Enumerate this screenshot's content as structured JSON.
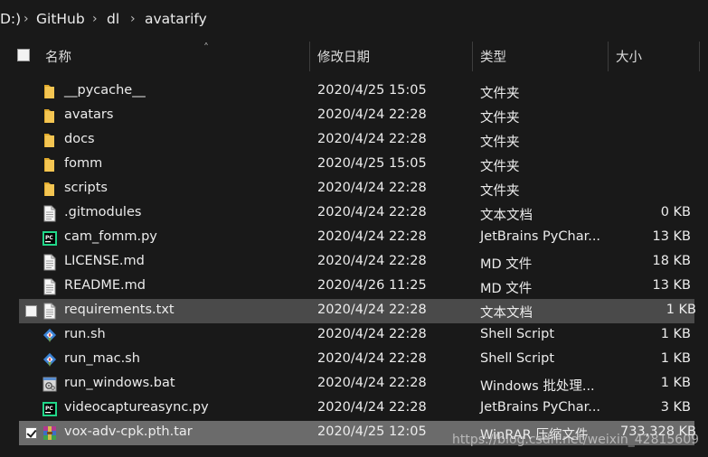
{
  "breadcrumb": {
    "drive": "D:)",
    "items": [
      "GitHub",
      "dl",
      "avatarify"
    ]
  },
  "columns": {
    "name": "名称",
    "date": "修改日期",
    "type": "类型",
    "size": "大小"
  },
  "rows": [
    {
      "name": "__pycache__",
      "date": "2020/4/25 15:05",
      "type": "文件夹",
      "size": "",
      "icon": "folder-icon"
    },
    {
      "name": "avatars",
      "date": "2020/4/24 22:28",
      "type": "文件夹",
      "size": "",
      "icon": "folder-icon"
    },
    {
      "name": "docs",
      "date": "2020/4/24 22:28",
      "type": "文件夹",
      "size": "",
      "icon": "folder-icon"
    },
    {
      "name": "fomm",
      "date": "2020/4/25 15:05",
      "type": "文件夹",
      "size": "",
      "icon": "folder-icon"
    },
    {
      "name": "scripts",
      "date": "2020/4/24 22:28",
      "type": "文件夹",
      "size": "",
      "icon": "folder-icon"
    },
    {
      "name": ".gitmodules",
      "date": "2020/4/24 22:28",
      "type": "文本文档",
      "size": "0 KB",
      "icon": "text-file-icon"
    },
    {
      "name": "cam_fomm.py",
      "date": "2020/4/24 22:28",
      "type": "JetBrains PyChar...",
      "size": "13 KB",
      "icon": "pycharm-file-icon"
    },
    {
      "name": "LICENSE.md",
      "date": "2020/4/24 22:28",
      "type": "MD 文件",
      "size": "18 KB",
      "icon": "text-file-icon"
    },
    {
      "name": "README.md",
      "date": "2020/4/26 11:25",
      "type": "MD 文件",
      "size": "13 KB",
      "icon": "text-file-icon"
    },
    {
      "name": "requirements.txt",
      "date": "2020/4/24 22:28",
      "type": "文本文档",
      "size": "1 KB",
      "icon": "text-file-icon",
      "state": "hover"
    },
    {
      "name": "run.sh",
      "date": "2020/4/24 22:28",
      "type": "Shell Script",
      "size": "1 KB",
      "icon": "shell-script-icon"
    },
    {
      "name": "run_mac.sh",
      "date": "2020/4/24 22:28",
      "type": "Shell Script",
      "size": "1 KB",
      "icon": "shell-script-icon"
    },
    {
      "name": "run_windows.bat",
      "date": "2020/4/24 22:28",
      "type": "Windows 批处理...",
      "size": "1 KB",
      "icon": "batch-file-icon"
    },
    {
      "name": "videocaptureasync.py",
      "date": "2020/4/24 22:28",
      "type": "JetBrains PyChar...",
      "size": "3 KB",
      "icon": "pycharm-file-icon"
    },
    {
      "name": "vox-adv-cpk.pth.tar",
      "date": "2020/4/25 12:05",
      "type": "WinRAR 压缩文件",
      "size": "733,328 KB",
      "icon": "winrar-archive-icon",
      "state": "selected"
    }
  ],
  "watermark": "https://blog.csdn.net/weixin_42815609",
  "colors": {
    "background": "#191919",
    "text": "#ececec",
    "hover": "#4a4a4a",
    "selected": "#6b6b6b",
    "folder": "#f4c552"
  }
}
